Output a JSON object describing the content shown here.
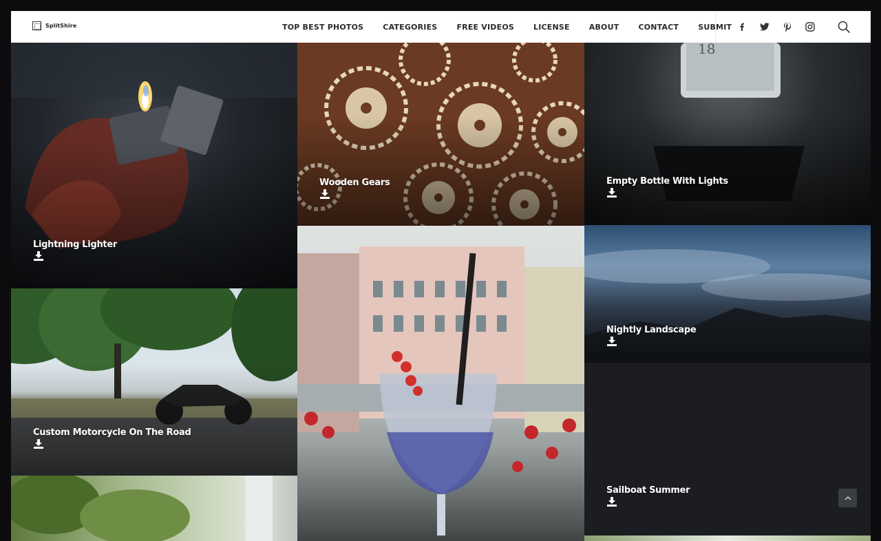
{
  "header": {
    "logo_text": "SplitShire",
    "nav": [
      {
        "label": "TOP BEST PHOTOS"
      },
      {
        "label": "CATEGORIES"
      },
      {
        "label": "FREE VIDEOS"
      },
      {
        "label": "LICENSE"
      },
      {
        "label": "ABOUT"
      },
      {
        "label": "CONTACT"
      },
      {
        "label": "SUBMIT"
      }
    ],
    "social_icons": [
      "facebook-icon",
      "twitter-icon",
      "pinterest-icon",
      "instagram-icon"
    ],
    "search_icon": "search-icon"
  },
  "photos": {
    "lighter": {
      "title": "Lightning Lighter"
    },
    "gears": {
      "title": "Wooden Gears"
    },
    "bottle": {
      "title": "Empty Bottle With Lights"
    },
    "motorcycle": {
      "title": "Custom Motorcycle On The Road"
    },
    "landscape": {
      "title": "Nightly Landscape"
    },
    "sailboat": {
      "title": "Sailboat Summer"
    }
  },
  "controls": {
    "scroll_top_icon": "chevron-up-icon"
  },
  "colors": {
    "header_bg": "#ffffff",
    "page_bg": "#16181c",
    "text_on_photo": "#ffffff"
  }
}
